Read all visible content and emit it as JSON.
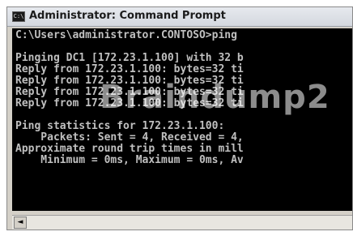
{
  "window": {
    "title": "Administrator: Command Prompt",
    "icon_text": "C:\\",
    "icon": "console-icon"
  },
  "console": {
    "lines": [
      "C:\\Users\\administrator.CONTOSO>ping",
      "",
      "Pinging DC1 [172.23.1.100] with 32 b",
      "Reply from 172.23.1.100: bytes=32 ti",
      "Reply from 172.23.1.100: bytes=32 ti",
      "Reply from 172.23.1.100: bytes=32 ti",
      "Reply from 172.23.1.100: bytes=32 ti",
      "",
      "Ping statistics for 172.23.1.100:",
      "    Packets: Sent = 4, Received = 4,",
      "Approximate round trip times in mill",
      "    Minimum = 0ms, Maximum = 0ms, Av"
    ],
    "watermark": "Braindump2",
    "colors": {
      "background": "#000000",
      "text": "#c0c0c0"
    }
  },
  "scrollbar": {
    "left_arrow": "◄",
    "icon": "scroll-left-arrow-icon"
  }
}
